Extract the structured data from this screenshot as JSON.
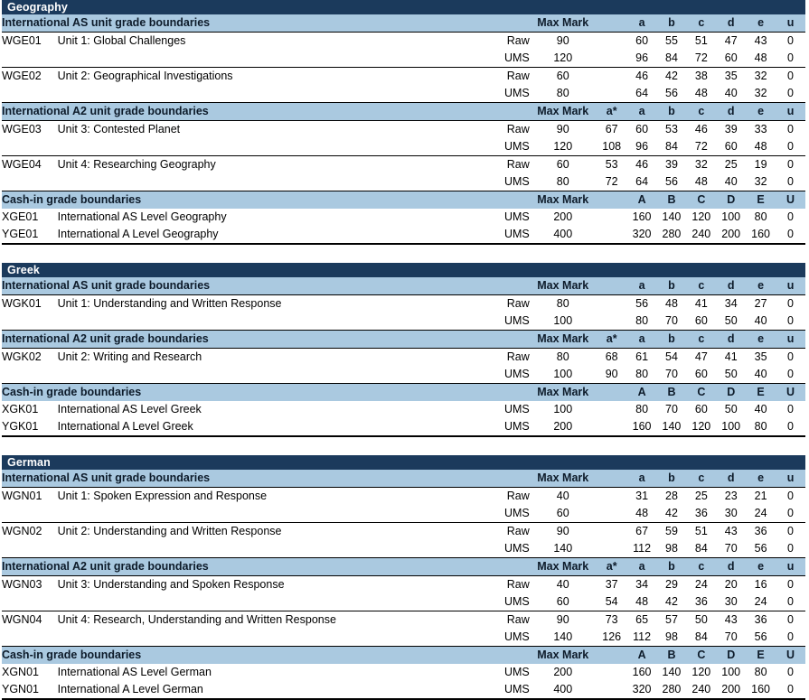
{
  "document": {
    "type": "grade-boundary-table",
    "colors": {
      "subject_bar": "#1b3a5c",
      "section_header": "#aac9e0",
      "text": "#000000",
      "page": "#ffffff"
    },
    "column_headers": {
      "max_mark": "Max Mark",
      "a_star": "a*",
      "lower": [
        "a",
        "b",
        "c",
        "d",
        "e",
        "u"
      ],
      "upper": [
        "A",
        "B",
        "C",
        "D",
        "E",
        "U"
      ]
    },
    "section_titles": {
      "as_unit": "International AS unit grade boundaries",
      "a2_unit": "International A2 unit grade boundaries",
      "cash_in": "Cash-in grade boundaries"
    },
    "row_types": {
      "raw": "Raw",
      "ums": "UMS"
    }
  },
  "subjects": [
    {
      "name": "Geography",
      "as_units": [
        {
          "code": "WGE01",
          "title": "Unit 1: Global Challenges",
          "rows": [
            {
              "type": "Raw",
              "max": "90",
              "grades": [
                "60",
                "55",
                "51",
                "47",
                "43",
                "0"
              ]
            },
            {
              "type": "UMS",
              "max": "120",
              "grades": [
                "96",
                "84",
                "72",
                "60",
                "48",
                "0"
              ]
            }
          ]
        },
        {
          "code": "WGE02",
          "title": "Unit 2: Geographical Investigations",
          "rows": [
            {
              "type": "Raw",
              "max": "60",
              "grades": [
                "46",
                "42",
                "38",
                "35",
                "32",
                "0"
              ]
            },
            {
              "type": "UMS",
              "max": "80",
              "grades": [
                "64",
                "56",
                "48",
                "40",
                "32",
                "0"
              ]
            }
          ]
        }
      ],
      "a2_units": [
        {
          "code": "WGE03",
          "title": "Unit 3: Contested Planet",
          "rows": [
            {
              "type": "Raw",
              "max": "90",
              "astar": "67",
              "grades": [
                "60",
                "53",
                "46",
                "39",
                "33",
                "0"
              ]
            },
            {
              "type": "UMS",
              "max": "120",
              "astar": "108",
              "grades": [
                "96",
                "84",
                "72",
                "60",
                "48",
                "0"
              ]
            }
          ]
        },
        {
          "code": "WGE04",
          "title": "Unit 4: Researching Geography",
          "rows": [
            {
              "type": "Raw",
              "max": "60",
              "astar": "53",
              "grades": [
                "46",
                "39",
                "32",
                "25",
                "19",
                "0"
              ]
            },
            {
              "type": "UMS",
              "max": "80",
              "astar": "72",
              "grades": [
                "64",
                "56",
                "48",
                "40",
                "32",
                "0"
              ]
            }
          ]
        }
      ],
      "cash_in": [
        {
          "code": "XGE01",
          "title": "International AS Level Geography",
          "type": "UMS",
          "max": "200",
          "grades": [
            "160",
            "140",
            "120",
            "100",
            "80",
            "0"
          ]
        },
        {
          "code": "YGE01",
          "title": "International A Level Geography",
          "type": "UMS",
          "max": "400",
          "grades": [
            "320",
            "280",
            "240",
            "200",
            "160",
            "0"
          ]
        }
      ]
    },
    {
      "name": "Greek",
      "as_units": [
        {
          "code": "WGK01",
          "title": "Unit 1: Understanding and Written Response",
          "rows": [
            {
              "type": "Raw",
              "max": "80",
              "grades": [
                "56",
                "48",
                "41",
                "34",
                "27",
                "0"
              ]
            },
            {
              "type": "UMS",
              "max": "100",
              "grades": [
                "80",
                "70",
                "60",
                "50",
                "40",
                "0"
              ]
            }
          ]
        }
      ],
      "a2_units": [
        {
          "code": "WGK02",
          "title": "Unit 2: Writing and Research",
          "rows": [
            {
              "type": "Raw",
              "max": "80",
              "astar": "68",
              "grades": [
                "61",
                "54",
                "47",
                "41",
                "35",
                "0"
              ]
            },
            {
              "type": "UMS",
              "max": "100",
              "astar": "90",
              "grades": [
                "80",
                "70",
                "60",
                "50",
                "40",
                "0"
              ]
            }
          ]
        }
      ],
      "cash_in": [
        {
          "code": "XGK01",
          "title": "International AS Level Greek",
          "type": "UMS",
          "max": "100",
          "grades": [
            "80",
            "70",
            "60",
            "50",
            "40",
            "0"
          ]
        },
        {
          "code": "YGK01",
          "title": "International A Level Greek",
          "type": "UMS",
          "max": "200",
          "grades": [
            "160",
            "140",
            "120",
            "100",
            "80",
            "0"
          ]
        }
      ]
    },
    {
      "name": "German",
      "as_units": [
        {
          "code": "WGN01",
          "title": "Unit 1: Spoken Expression and Response",
          "rows": [
            {
              "type": "Raw",
              "max": "40",
              "grades": [
                "31",
                "28",
                "25",
                "23",
                "21",
                "0"
              ]
            },
            {
              "type": "UMS",
              "max": "60",
              "grades": [
                "48",
                "42",
                "36",
                "30",
                "24",
                "0"
              ]
            }
          ]
        },
        {
          "code": "WGN02",
          "title": "Unit 2: Understanding and Written Response",
          "rows": [
            {
              "type": "Raw",
              "max": "90",
              "grades": [
                "67",
                "59",
                "51",
                "43",
                "36",
                "0"
              ]
            },
            {
              "type": "UMS",
              "max": "140",
              "grades": [
                "112",
                "98",
                "84",
                "70",
                "56",
                "0"
              ]
            }
          ]
        }
      ],
      "a2_units": [
        {
          "code": "WGN03",
          "title": "Unit 3: Understanding and Spoken Response",
          "rows": [
            {
              "type": "Raw",
              "max": "40",
              "astar": "37",
              "grades": [
                "34",
                "29",
                "24",
                "20",
                "16",
                "0"
              ]
            },
            {
              "type": "UMS",
              "max": "60",
              "astar": "54",
              "grades": [
                "48",
                "42",
                "36",
                "30",
                "24",
                "0"
              ]
            }
          ]
        },
        {
          "code": "WGN04",
          "title": "Unit 4: Research, Understanding and Written Response",
          "rows": [
            {
              "type": "Raw",
              "max": "90",
              "astar": "73",
              "grades": [
                "65",
                "57",
                "50",
                "43",
                "36",
                "0"
              ]
            },
            {
              "type": "UMS",
              "max": "140",
              "astar": "126",
              "grades": [
                "112",
                "98",
                "84",
                "70",
                "56",
                "0"
              ]
            }
          ]
        }
      ],
      "cash_in": [
        {
          "code": "XGN01",
          "title": "International AS Level German",
          "type": "UMS",
          "max": "200",
          "grades": [
            "160",
            "140",
            "120",
            "100",
            "80",
            "0"
          ]
        },
        {
          "code": "YGN01",
          "title": "International A Level German",
          "type": "UMS",
          "max": "400",
          "grades": [
            "320",
            "280",
            "240",
            "200",
            "160",
            "0"
          ]
        }
      ]
    }
  ]
}
